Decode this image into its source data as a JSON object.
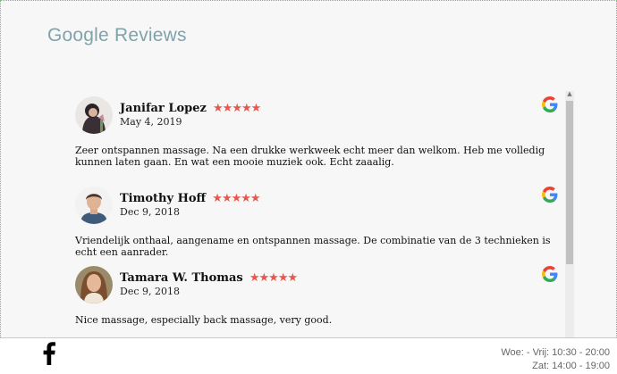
{
  "widget": {
    "title": "Google Reviews"
  },
  "reviews": [
    {
      "name": "Janifar Lopez",
      "stars": "★★★★★",
      "rating": 5,
      "date": "May 4, 2019",
      "text": "Zeer ontspannen massage. Na een drukke werkweek echt meer dan welkom. Heb me volledig kunnen laten gaan. En wat een mooie muziek ook. Echt zaaalig.",
      "source_icon": "google-icon"
    },
    {
      "name": "Timothy Hoff",
      "stars": "★★★★★",
      "rating": 5,
      "date": "Dec 9, 2018",
      "text": "Vriendelijk onthaal, aangename en ontspannen massage. De combinatie van de 3 technieken is echt een aanrader.",
      "source_icon": "google-icon"
    },
    {
      "name": "Tamara W. Thomas",
      "stars": "★★★★★",
      "rating": 5,
      "date": "Dec 9, 2018",
      "text": "Nice massage, especially back massage, very good.",
      "source_icon": "google-icon"
    }
  ],
  "footer": {
    "social_icon": "facebook-icon",
    "hours_line1": "Woe: - Vrij: 10:30 - 20:00",
    "hours_line2": "Zat: 14:00 - 19:00"
  },
  "colors": {
    "star": "#e8574d",
    "title": "#7ea3ad",
    "background": "#f7f7f7"
  }
}
